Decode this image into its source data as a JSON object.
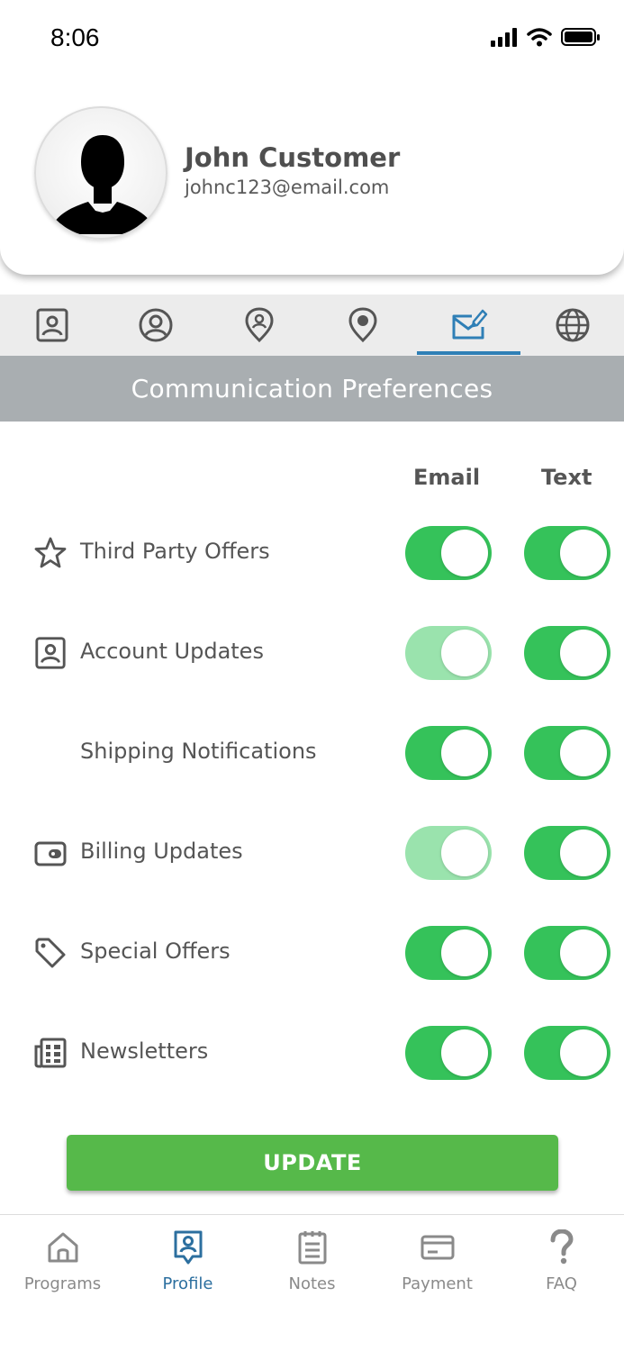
{
  "status_bar": {
    "time": "8:06"
  },
  "profile": {
    "name": "John Customer",
    "email": "johnc123@email.com"
  },
  "tabs": [
    {
      "icon": "contact-card-icon",
      "active": false
    },
    {
      "icon": "user-circle-icon",
      "active": false
    },
    {
      "icon": "user-location-pin-icon",
      "active": false
    },
    {
      "icon": "location-pin-icon",
      "active": false
    },
    {
      "icon": "envelope-edit-icon",
      "active": true
    },
    {
      "icon": "globe-icon",
      "active": false
    }
  ],
  "section": {
    "title": "Communication Preferences"
  },
  "columns": {
    "email": "Email",
    "text": "Text"
  },
  "preferences": [
    {
      "label": "Third Party Offers",
      "icon": "star-icon",
      "email": true,
      "email_faded": false,
      "text": true
    },
    {
      "label": "Account Updates",
      "icon": "contact-card-icon",
      "email": true,
      "email_faded": true,
      "text": true
    },
    {
      "label": "Shipping Notifications",
      "icon": "",
      "email": true,
      "email_faded": false,
      "text": true
    },
    {
      "label": "Billing Updates",
      "icon": "wallet-icon",
      "email": true,
      "email_faded": true,
      "text": true
    },
    {
      "label": "Special Offers",
      "icon": "tag-icon",
      "email": true,
      "email_faded": false,
      "text": true
    },
    {
      "label": "Newsletters",
      "icon": "newspaper-icon",
      "email": true,
      "email_faded": false,
      "text": true
    }
  ],
  "actions": {
    "update_label": "UPDATE"
  },
  "bottom_nav": [
    {
      "label": "Programs",
      "icon": "home-icon",
      "active": false
    },
    {
      "label": "Profile",
      "icon": "profile-badge-icon",
      "active": true
    },
    {
      "label": "Notes",
      "icon": "notepad-icon",
      "active": false
    },
    {
      "label": "Payment",
      "icon": "credit-card-icon",
      "active": false
    },
    {
      "label": "FAQ",
      "icon": "question-mark-icon",
      "active": false
    }
  ],
  "colors": {
    "toggle_on": "#35c25a",
    "toggle_on_faded": "#9ae3ad",
    "update_button": "#56b94a",
    "active_tab": "#2f7fb6",
    "section_banner": "#a9aeb1"
  }
}
